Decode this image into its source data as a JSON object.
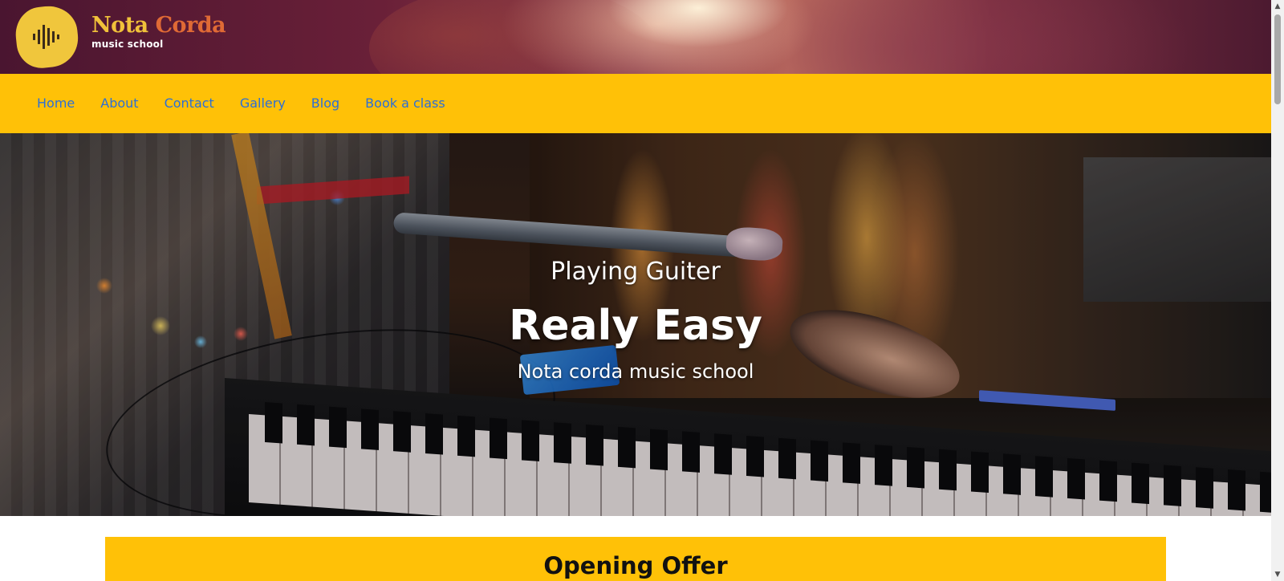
{
  "brand": {
    "name_part1": "Nota",
    "name_part2": "Corda",
    "tagline": "music school",
    "logo_icon": "soundwave-icon"
  },
  "nav": {
    "items": [
      {
        "label": "Home"
      },
      {
        "label": "About"
      },
      {
        "label": "Contact"
      },
      {
        "label": "Gallery"
      },
      {
        "label": "Blog"
      },
      {
        "label": "Book a class"
      }
    ]
  },
  "hero": {
    "line1": "Playing Guiter",
    "line2": "Realy Easy",
    "line3": "Nota corda music school"
  },
  "offer": {
    "title": "Opening Offer"
  },
  "colors": {
    "accent_yellow": "#ffc107",
    "link_blue": "#2c6fd6",
    "brand_yellow": "#f0c13a",
    "brand_orange": "#e06a35"
  },
  "scrollbar": {
    "up_icon": "▲",
    "down_icon": "▼"
  }
}
